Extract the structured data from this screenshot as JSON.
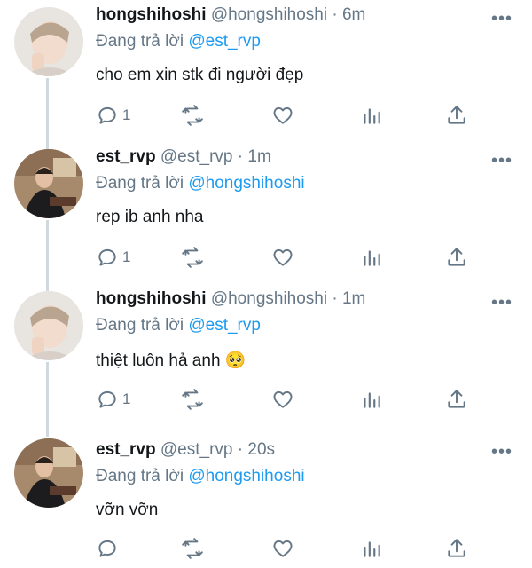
{
  "tweets": [
    {
      "name": "hongshihoshi",
      "handle": "@hongshihoshi",
      "time": "6m",
      "reply_prefix": "Đang trả lời",
      "reply_to": "@est_rvp",
      "text": "cho em xin stk đi người đẹp",
      "reply_count": "1",
      "avatar": "hongshihoshi-avatar"
    },
    {
      "name": "est_rvp",
      "handle": "@est_rvp",
      "time": "1m",
      "reply_prefix": "Đang trả lời",
      "reply_to": "@hongshihoshi",
      "text": "rep ib anh nha",
      "reply_count": "1",
      "avatar": "est_rvp-avatar"
    },
    {
      "name": "hongshihoshi",
      "handle": "@hongshihoshi",
      "time": "1m",
      "reply_prefix": "Đang trả lời",
      "reply_to": "@est_rvp",
      "text": "thiệt luôn hả anh 🥺",
      "reply_count": "1",
      "avatar": "hongshihoshi-avatar"
    },
    {
      "name": "est_rvp",
      "handle": "@est_rvp",
      "time": "20s",
      "reply_prefix": "Đang trả lời",
      "reply_to": "@hongshihoshi",
      "text": "vỡn vỡn",
      "reply_count": "",
      "avatar": "est_rvp-avatar"
    }
  ],
  "separator": "·",
  "more_glyph": "•••",
  "colors": {
    "accent": "#1d9bf0",
    "muted": "#657786",
    "text": "#14171a",
    "thread_line": "#cfd9de"
  },
  "icons": [
    "reply-icon",
    "retweet-icon",
    "like-icon",
    "stats-icon",
    "share-icon",
    "more-icon"
  ]
}
